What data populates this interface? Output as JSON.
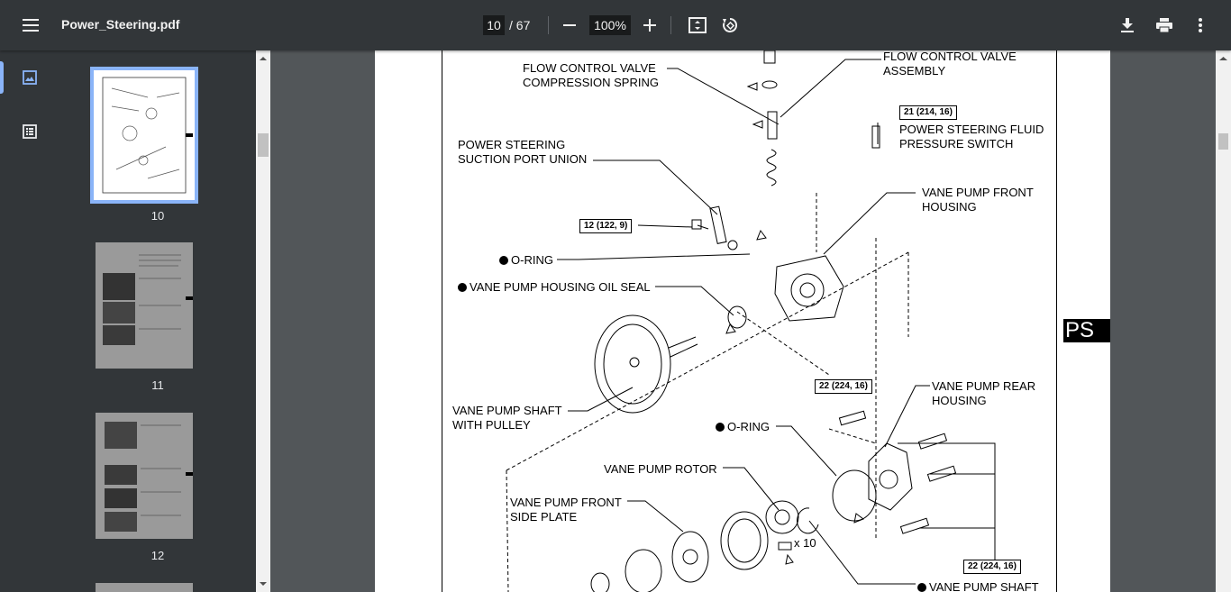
{
  "toolbar": {
    "menu_icon": "hamburger-menu-icon",
    "title": "Power_Steering.pdf",
    "page_current": "10",
    "page_total": "/ 67",
    "zoom": "100%",
    "zoom_out_icon": "minus-icon",
    "zoom_in_icon": "plus-icon",
    "fit_icon": "fit-page-icon",
    "rotate_icon": "rotate-icon",
    "download_icon": "download-icon",
    "print_icon": "print-icon",
    "more_icon": "more-vert-icon"
  },
  "sidenav": {
    "items": [
      {
        "icon": "thumbnail-view-icon",
        "active": true
      },
      {
        "icon": "outline-view-icon",
        "active": false
      }
    ]
  },
  "thumbnails": [
    {
      "label": "10",
      "selected": true
    },
    {
      "label": "11",
      "selected": false
    },
    {
      "label": "12",
      "selected": false
    }
  ],
  "page": {
    "section_tab": "PS",
    "labels": {
      "fcv_spring": "FLOW CONTROL VALVE\nCOMPRESSION SPRING",
      "fcv_assembly": "FLOW CONTROL VALVE\nASSEMBLY",
      "ps_switch": "POWER STEERING FLUID\nPRESSURE SWITCH",
      "suction_union": "POWER STEERING\nSUCTION PORT UNION",
      "front_housing": "VANE PUMP FRONT\nHOUSING",
      "oring1": "O-RING",
      "oil_seal": "VANE PUMP HOUSING OIL SEAL",
      "shaft_pulley": "VANE PUMP SHAFT\nWITH PULLEY",
      "rear_housing": "VANE PUMP REAR\nHOUSING",
      "oring2": "O-RING",
      "rotor": "VANE PUMP ROTOR",
      "front_side_plate": "VANE PUMP FRONT\nSIDE PLATE",
      "x10": "x 10",
      "pump_shaft": "VANE PUMP SHAFT"
    },
    "torques": {
      "t1": "21 (214, 16)",
      "t2": "12 (122, 9)",
      "t3": "22 (224, 16)",
      "t4": "22 (224, 16)"
    }
  }
}
